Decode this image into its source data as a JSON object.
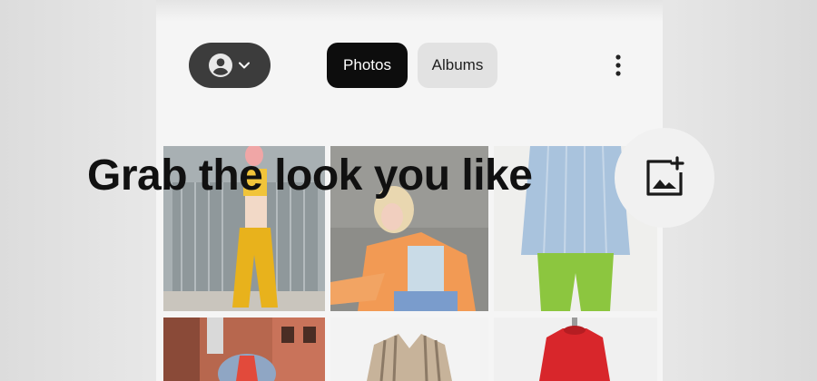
{
  "top_bar": {
    "account_icon": "account-circle-icon",
    "dropdown_icon": "chevron-down-icon",
    "more_icon": "more-vertical-icon"
  },
  "tabs": [
    {
      "label": "Photos",
      "selected": true
    },
    {
      "label": "Albums",
      "selected": false
    }
  ],
  "headline": "Grab the look you like",
  "add_photo_icon": "add-photo-icon",
  "colors": {
    "chip_bg": "#3c3c3c",
    "tab_selected_bg": "#0d0d0d",
    "tab_unselected_bg": "#e2e2e2",
    "headline": "#111111"
  }
}
